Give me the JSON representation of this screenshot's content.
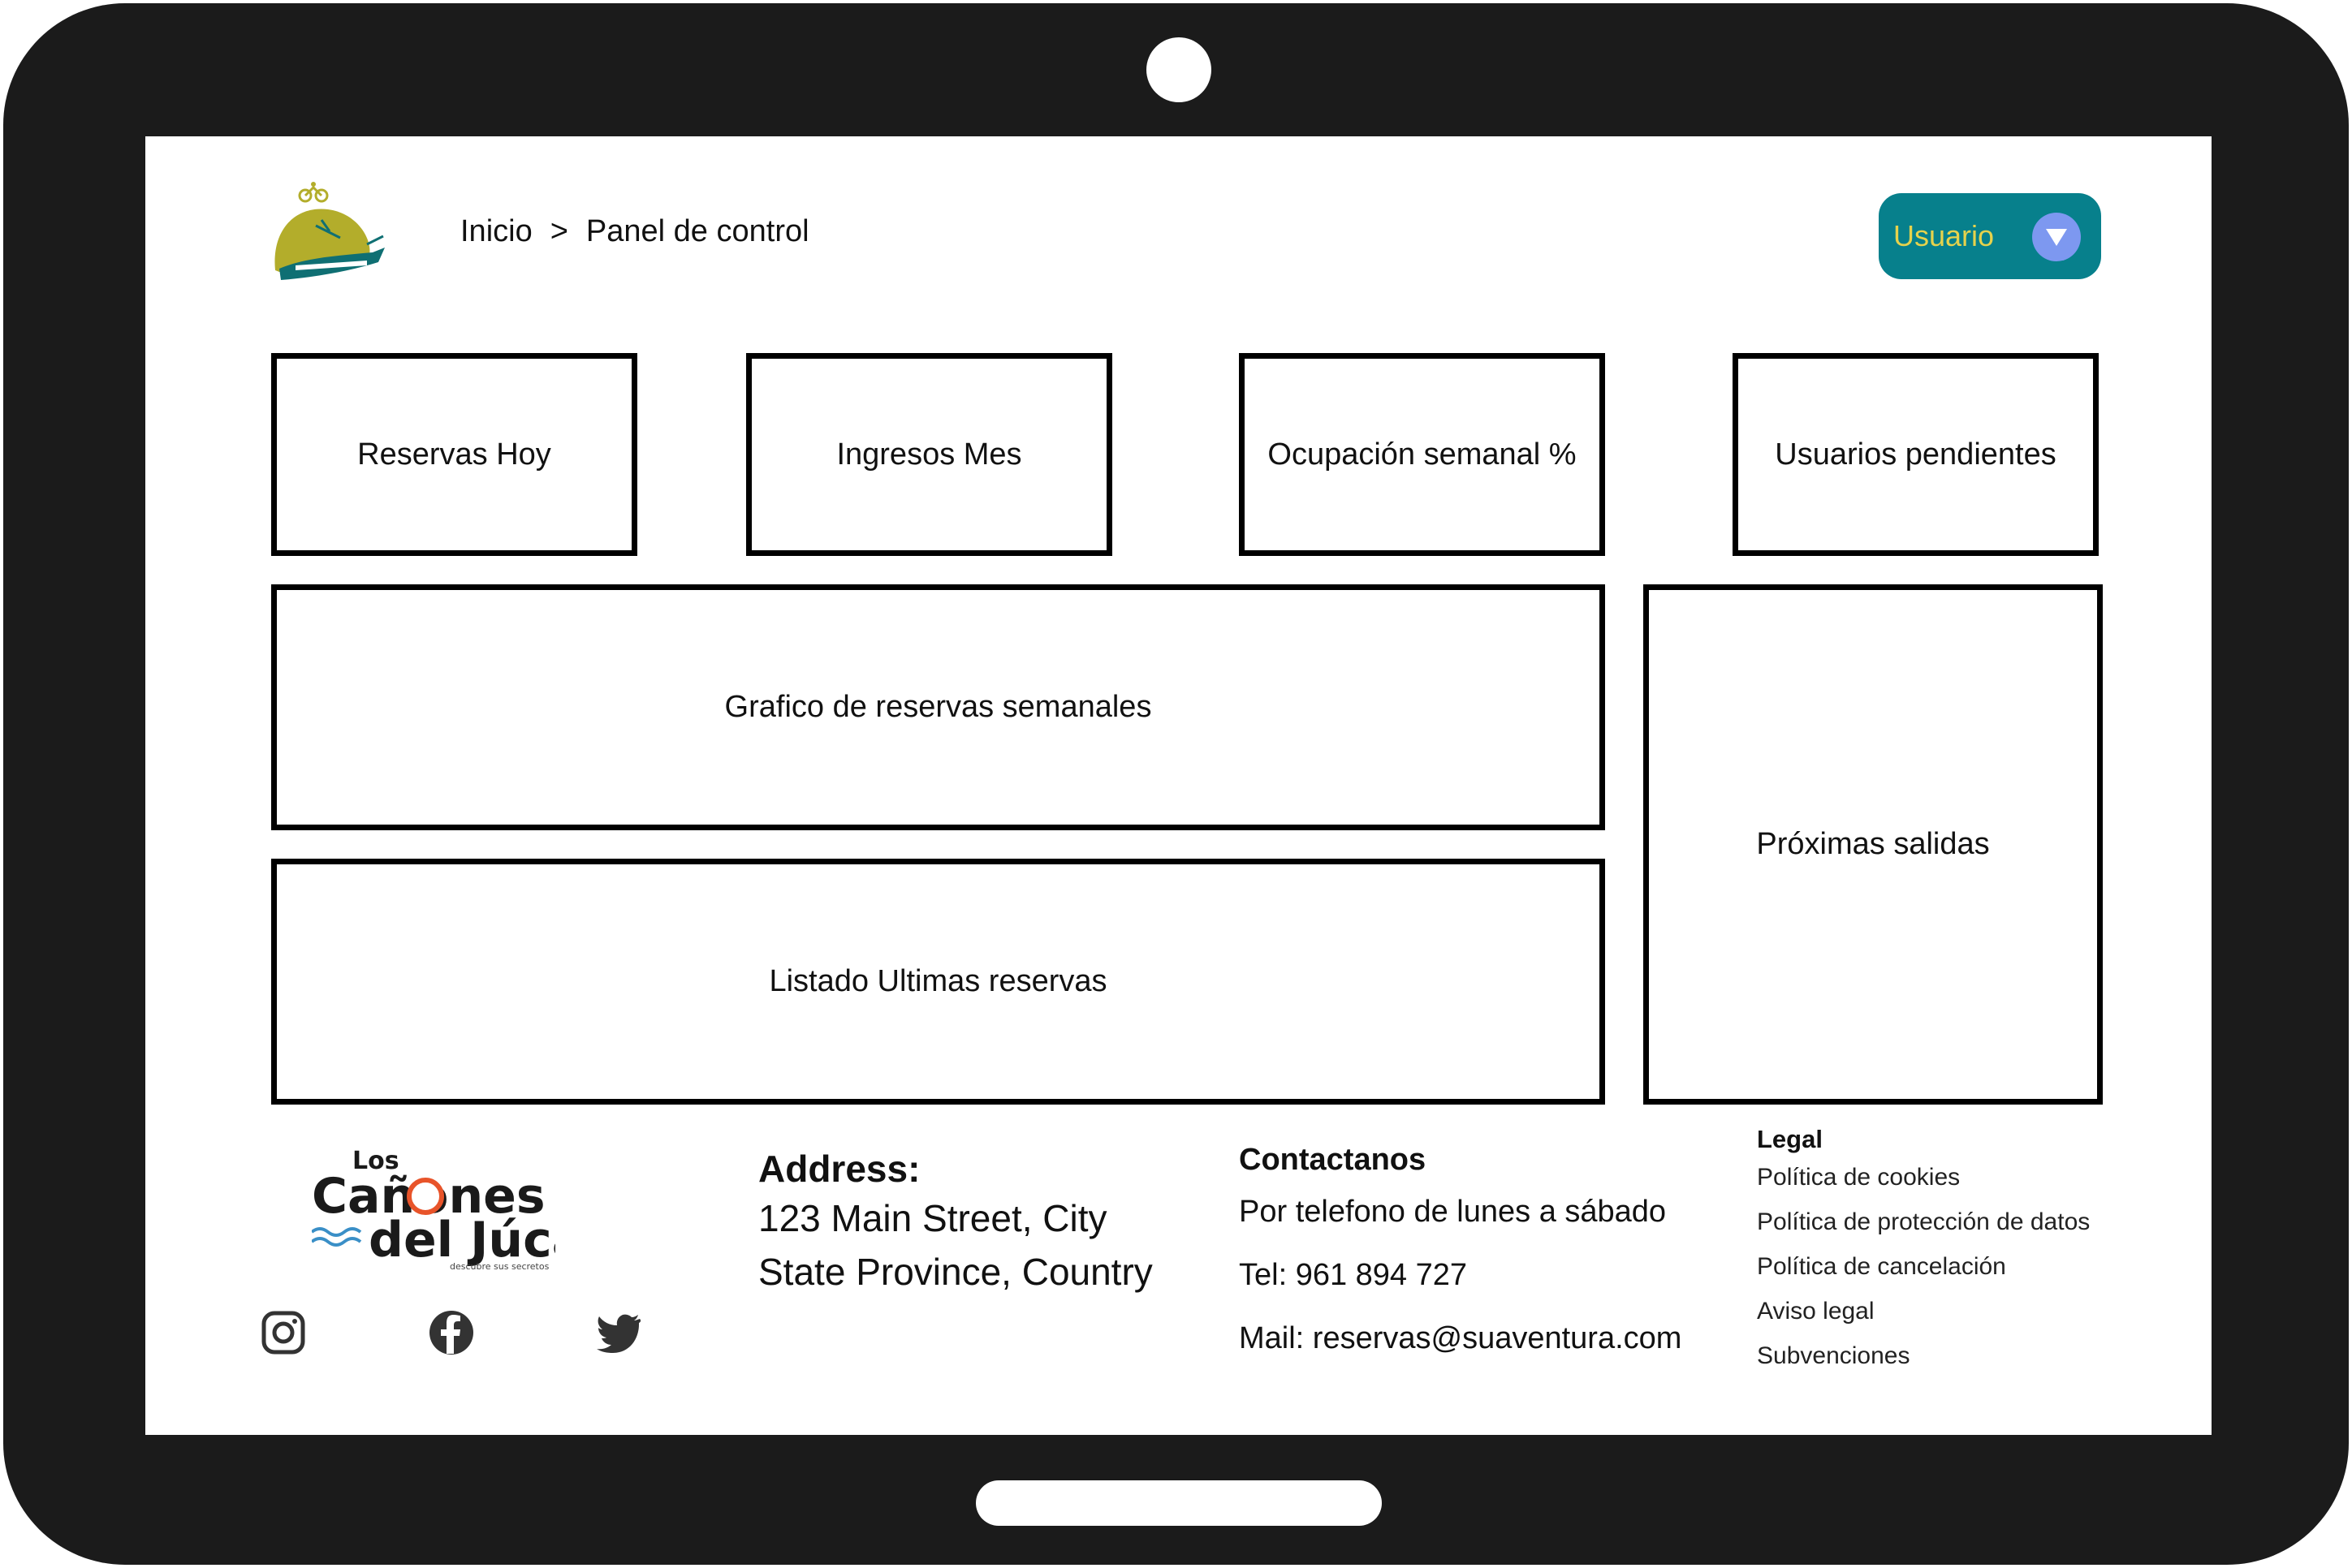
{
  "header": {
    "breadcrumb": {
      "home": "Inicio",
      "separator": ">",
      "current": "Panel de control"
    },
    "user_menu": {
      "label": "Usuario",
      "icon": "chevron-down-icon"
    }
  },
  "dashboard": {
    "kpis": [
      {
        "label": "Reservas Hoy"
      },
      {
        "label": "Ingresos Mes"
      },
      {
        "label": "Ocupación semanal %"
      },
      {
        "label": "Usuarios pendientes"
      }
    ],
    "weekly_chart": {
      "label": "Grafico de reservas semanales"
    },
    "latest_bookings": {
      "label": "Listado Ultimas reservas"
    },
    "upcoming_departures": {
      "label": "Próximas salidas"
    }
  },
  "footer": {
    "logo": {
      "line1": "Los",
      "line2": "Cañones",
      "line3": "del Júcar",
      "tagline": "descubre sus secretos"
    },
    "social": [
      "instagram-icon",
      "facebook-icon",
      "twitter-icon"
    ],
    "address": {
      "title": "Address:",
      "line1": "123 Main Street, City",
      "line2": "State Province, Country"
    },
    "contact": {
      "title": "Contactanos",
      "hours": "Por telefono de lunes a sábado",
      "phone": "Tel: 961 894 727",
      "mail": "Mail: reservas@suaventura.com"
    },
    "legal": {
      "title": "Legal",
      "links": [
        "Política de cookies",
        "Política de protección de datos",
        "Política de cancelación",
        "Aviso legal",
        "Subvenciones"
      ]
    }
  },
  "colors": {
    "device_frame": "#1b1b1b",
    "accent": "#07808c",
    "accent_text": "#e6d24c",
    "caret": "#7d98f0",
    "logo_olive": "#b3ad2b",
    "logo_teal": "#0f6f73"
  }
}
